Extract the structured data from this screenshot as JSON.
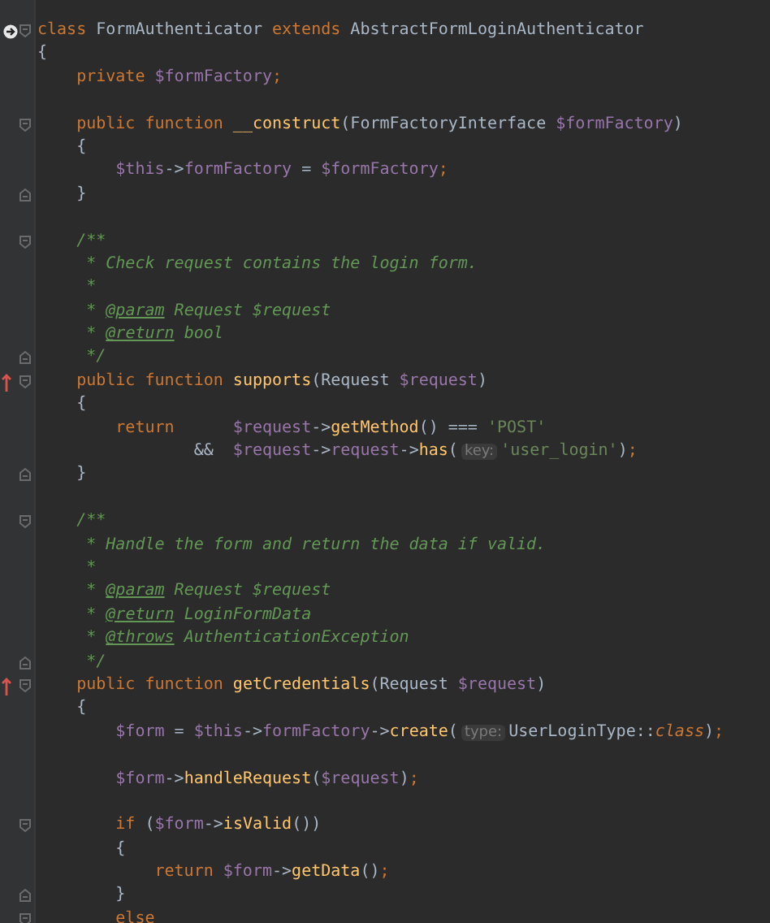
{
  "editor": {
    "lines": [
      {
        "kind": "code",
        "markers": [
          {
            "kind": "debug"
          },
          {
            "kind": "fold-start"
          }
        ],
        "tokens": [
          {
            "kind": "kw",
            "text": "class"
          },
          {
            "kind": "pl",
            "text": " FormAuthenticator "
          },
          {
            "kind": "kw",
            "text": "extends"
          },
          {
            "kind": "pl",
            "text": " AbstractFormLoginAuthenticator"
          }
        ]
      },
      {
        "kind": "code",
        "tokens": [
          {
            "kind": "pl",
            "text": "{"
          }
        ]
      },
      {
        "kind": "code",
        "tokens": [
          {
            "kind": "kw",
            "text": "    private "
          },
          {
            "kind": "var",
            "text": "$formFactory"
          },
          {
            "kind": "kw",
            "text": ";"
          }
        ]
      },
      {
        "kind": "blank"
      },
      {
        "kind": "code",
        "markers": [
          {
            "kind": "fold-start"
          }
        ],
        "tokens": [
          {
            "kind": "kw",
            "text": "    public function "
          },
          {
            "kind": "fn",
            "text": "__construct"
          },
          {
            "kind": "pl",
            "text": "(FormFactoryInterface "
          },
          {
            "kind": "var",
            "text": "$formFactory"
          },
          {
            "kind": "pl",
            "text": ")"
          }
        ]
      },
      {
        "kind": "code",
        "tokens": [
          {
            "kind": "pl",
            "text": "    {"
          }
        ]
      },
      {
        "kind": "code",
        "tokens": [
          {
            "kind": "var",
            "text": "        $this"
          },
          {
            "kind": "pl",
            "text": "->"
          },
          {
            "kind": "var",
            "text": "formFactory"
          },
          {
            "kind": "pl",
            "text": " = "
          },
          {
            "kind": "var",
            "text": "$formFactory"
          },
          {
            "kind": "kw",
            "text": ";"
          }
        ]
      },
      {
        "kind": "code",
        "markers": [
          {
            "kind": "fold-end"
          }
        ],
        "tokens": [
          {
            "kind": "pl",
            "text": "    }"
          }
        ]
      },
      {
        "kind": "blank"
      },
      {
        "kind": "code",
        "markers": [
          {
            "kind": "fold-start"
          }
        ],
        "tokens": [
          {
            "kind": "doc",
            "text": "    /**"
          }
        ]
      },
      {
        "kind": "code",
        "tokens": [
          {
            "kind": "doc",
            "text": "     * Check request contains the login form."
          }
        ]
      },
      {
        "kind": "code",
        "tokens": [
          {
            "kind": "doc",
            "text": "     *"
          }
        ]
      },
      {
        "kind": "code",
        "tokens": [
          {
            "kind": "doc",
            "text": "     * "
          },
          {
            "kind": "doctag",
            "text": "@param"
          },
          {
            "kind": "doc",
            "text": " Request $request"
          }
        ]
      },
      {
        "kind": "code",
        "tokens": [
          {
            "kind": "doc",
            "text": "     * "
          },
          {
            "kind": "doctag",
            "text": "@return"
          },
          {
            "kind": "doc",
            "text": " bool"
          }
        ]
      },
      {
        "kind": "code",
        "markers": [
          {
            "kind": "fold-end"
          }
        ],
        "tokens": [
          {
            "kind": "doc",
            "text": "     */"
          }
        ]
      },
      {
        "kind": "code",
        "markers": [
          {
            "kind": "override"
          },
          {
            "kind": "fold-start"
          }
        ],
        "tokens": [
          {
            "kind": "kw",
            "text": "    public function "
          },
          {
            "kind": "fn",
            "text": "supports"
          },
          {
            "kind": "pl",
            "text": "(Request "
          },
          {
            "kind": "var",
            "text": "$request"
          },
          {
            "kind": "pl",
            "text": ")"
          }
        ]
      },
      {
        "kind": "code",
        "tokens": [
          {
            "kind": "pl",
            "text": "    {"
          }
        ]
      },
      {
        "kind": "code",
        "tokens": [
          {
            "kind": "kw",
            "text": "        return"
          },
          {
            "kind": "var",
            "text": "      $request"
          },
          {
            "kind": "pl",
            "text": "->"
          },
          {
            "kind": "fn",
            "text": "getMethod"
          },
          {
            "kind": "pl",
            "text": "() === "
          },
          {
            "kind": "str",
            "text": "'POST'"
          }
        ]
      },
      {
        "kind": "code",
        "tokens": [
          {
            "kind": "pl",
            "text": "                &&  "
          },
          {
            "kind": "var",
            "text": "$request"
          },
          {
            "kind": "pl",
            "text": "->"
          },
          {
            "kind": "var",
            "text": "request"
          },
          {
            "kind": "pl",
            "text": "->"
          },
          {
            "kind": "fn",
            "text": "has"
          },
          {
            "kind": "pl",
            "text": "("
          },
          {
            "kind": "hint",
            "text": "key:"
          },
          {
            "kind": "str",
            "text": "'user_login'"
          },
          {
            "kind": "pl",
            "text": ")"
          },
          {
            "kind": "kw",
            "text": ";"
          }
        ]
      },
      {
        "kind": "code",
        "markers": [
          {
            "kind": "fold-end"
          }
        ],
        "tokens": [
          {
            "kind": "pl",
            "text": "    }"
          }
        ]
      },
      {
        "kind": "blank"
      },
      {
        "kind": "code",
        "markers": [
          {
            "kind": "fold-start"
          }
        ],
        "tokens": [
          {
            "kind": "doc",
            "text": "    /**"
          }
        ]
      },
      {
        "kind": "code",
        "tokens": [
          {
            "kind": "doc",
            "text": "     * Handle the form and return the data if valid."
          }
        ]
      },
      {
        "kind": "code",
        "tokens": [
          {
            "kind": "doc",
            "text": "     *"
          }
        ]
      },
      {
        "kind": "code",
        "tokens": [
          {
            "kind": "doc",
            "text": "     * "
          },
          {
            "kind": "doctag",
            "text": "@param"
          },
          {
            "kind": "doc",
            "text": " Request $request"
          }
        ]
      },
      {
        "kind": "code",
        "tokens": [
          {
            "kind": "doc",
            "text": "     * "
          },
          {
            "kind": "doctag",
            "text": "@return"
          },
          {
            "kind": "doc",
            "text": " LoginFormData"
          }
        ]
      },
      {
        "kind": "code",
        "tokens": [
          {
            "kind": "doc",
            "text": "     * "
          },
          {
            "kind": "doctag",
            "text": "@throws"
          },
          {
            "kind": "doc",
            "text": " AuthenticationException"
          }
        ]
      },
      {
        "kind": "code",
        "markers": [
          {
            "kind": "fold-end"
          }
        ],
        "tokens": [
          {
            "kind": "doc",
            "text": "     */"
          }
        ]
      },
      {
        "kind": "code",
        "markers": [
          {
            "kind": "override"
          },
          {
            "kind": "fold-start"
          }
        ],
        "tokens": [
          {
            "kind": "kw",
            "text": "    public function "
          },
          {
            "kind": "fn",
            "text": "getCredentials"
          },
          {
            "kind": "pl",
            "text": "(Request "
          },
          {
            "kind": "var",
            "text": "$request"
          },
          {
            "kind": "pl",
            "text": ")"
          }
        ]
      },
      {
        "kind": "code",
        "tokens": [
          {
            "kind": "pl",
            "text": "    {"
          }
        ]
      },
      {
        "kind": "code",
        "tokens": [
          {
            "kind": "var",
            "text": "        $form"
          },
          {
            "kind": "pl",
            "text": " = "
          },
          {
            "kind": "var",
            "text": "$this"
          },
          {
            "kind": "pl",
            "text": "->"
          },
          {
            "kind": "var",
            "text": "formFactory"
          },
          {
            "kind": "pl",
            "text": "->"
          },
          {
            "kind": "fn",
            "text": "create"
          },
          {
            "kind": "pl",
            "text": "("
          },
          {
            "kind": "hint",
            "text": "type:"
          },
          {
            "kind": "pl",
            "text": "UserLoginType::"
          },
          {
            "kind": "kwi",
            "text": "class"
          },
          {
            "kind": "pl",
            "text": ")"
          },
          {
            "kind": "kw",
            "text": ";"
          }
        ]
      },
      {
        "kind": "blank"
      },
      {
        "kind": "code",
        "tokens": [
          {
            "kind": "var",
            "text": "        $form"
          },
          {
            "kind": "pl",
            "text": "->"
          },
          {
            "kind": "fn",
            "text": "handleRequest"
          },
          {
            "kind": "pl",
            "text": "("
          },
          {
            "kind": "var",
            "text": "$request"
          },
          {
            "kind": "pl",
            "text": ")"
          },
          {
            "kind": "kw",
            "text": ";"
          }
        ]
      },
      {
        "kind": "blank"
      },
      {
        "kind": "code",
        "markers": [
          {
            "kind": "fold-start"
          }
        ],
        "tokens": [
          {
            "kind": "kw",
            "text": "        if"
          },
          {
            "kind": "pl",
            "text": " ("
          },
          {
            "kind": "var",
            "text": "$form"
          },
          {
            "kind": "pl",
            "text": "->"
          },
          {
            "kind": "fn",
            "text": "isValid"
          },
          {
            "kind": "pl",
            "text": "())"
          }
        ]
      },
      {
        "kind": "code",
        "tokens": [
          {
            "kind": "pl",
            "text": "        {"
          }
        ]
      },
      {
        "kind": "code",
        "tokens": [
          {
            "kind": "kw",
            "text": "            return "
          },
          {
            "kind": "var",
            "text": "$form"
          },
          {
            "kind": "pl",
            "text": "->"
          },
          {
            "kind": "fn",
            "text": "getData"
          },
          {
            "kind": "pl",
            "text": "()"
          },
          {
            "kind": "kw",
            "text": ";"
          }
        ]
      },
      {
        "kind": "code",
        "markers": [
          {
            "kind": "fold-end"
          }
        ],
        "tokens": [
          {
            "kind": "pl",
            "text": "        }"
          }
        ]
      },
      {
        "kind": "code",
        "markers": [
          {
            "kind": "fold-start"
          }
        ],
        "tokens": [
          {
            "kind": "kw",
            "text": "        else"
          }
        ]
      }
    ]
  }
}
